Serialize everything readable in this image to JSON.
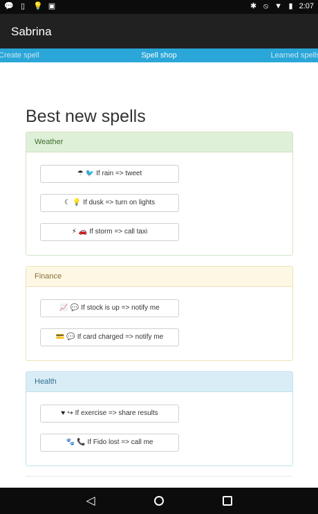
{
  "status_bar": {
    "time": "2:07",
    "left_icons": [
      "chat-icon",
      "phone-outline-icon",
      "bulb-icon",
      "image-icon"
    ],
    "right_icons": [
      "bluetooth-icon",
      "blocked-icon",
      "wifi-icon",
      "battery-icon"
    ]
  },
  "app_bar": {
    "title": "Sabrina"
  },
  "tabs": {
    "left": "Create spell",
    "center": "Spell shop",
    "right": "Learned spells"
  },
  "main": {
    "heading": "Best new spells",
    "panels": [
      {
        "title": "Weather",
        "spells": [
          {
            "icons": [
              "umbrella-icon",
              "twitter-icon"
            ],
            "label": "If rain => tweet"
          },
          {
            "icons": [
              "moon-icon",
              "bulb-icon"
            ],
            "label": "If dusk => turn on lights"
          },
          {
            "icons": [
              "lightning-icon",
              "car-icon"
            ],
            "label": "If storm => call taxi"
          }
        ]
      },
      {
        "title": "Finance",
        "spells": [
          {
            "icons": [
              "line-chart-icon",
              "speech-bubble-icon"
            ],
            "label": "If stock is up => notify me"
          },
          {
            "icons": [
              "credit-card-icon",
              "speech-bubble-icon"
            ],
            "label": "If card charged => notify me"
          }
        ]
      },
      {
        "title": "Health",
        "spells": [
          {
            "icons": [
              "heartbeat-icon",
              "share-icon"
            ],
            "label": "If exercise => share results"
          },
          {
            "icons": [
              "paw-icon",
              "phone-icon"
            ],
            "label": "If Fido lost => call me"
          }
        ]
      }
    ]
  },
  "nav_bar": {
    "buttons": [
      "back-icon",
      "home-icon",
      "recents-icon"
    ]
  }
}
